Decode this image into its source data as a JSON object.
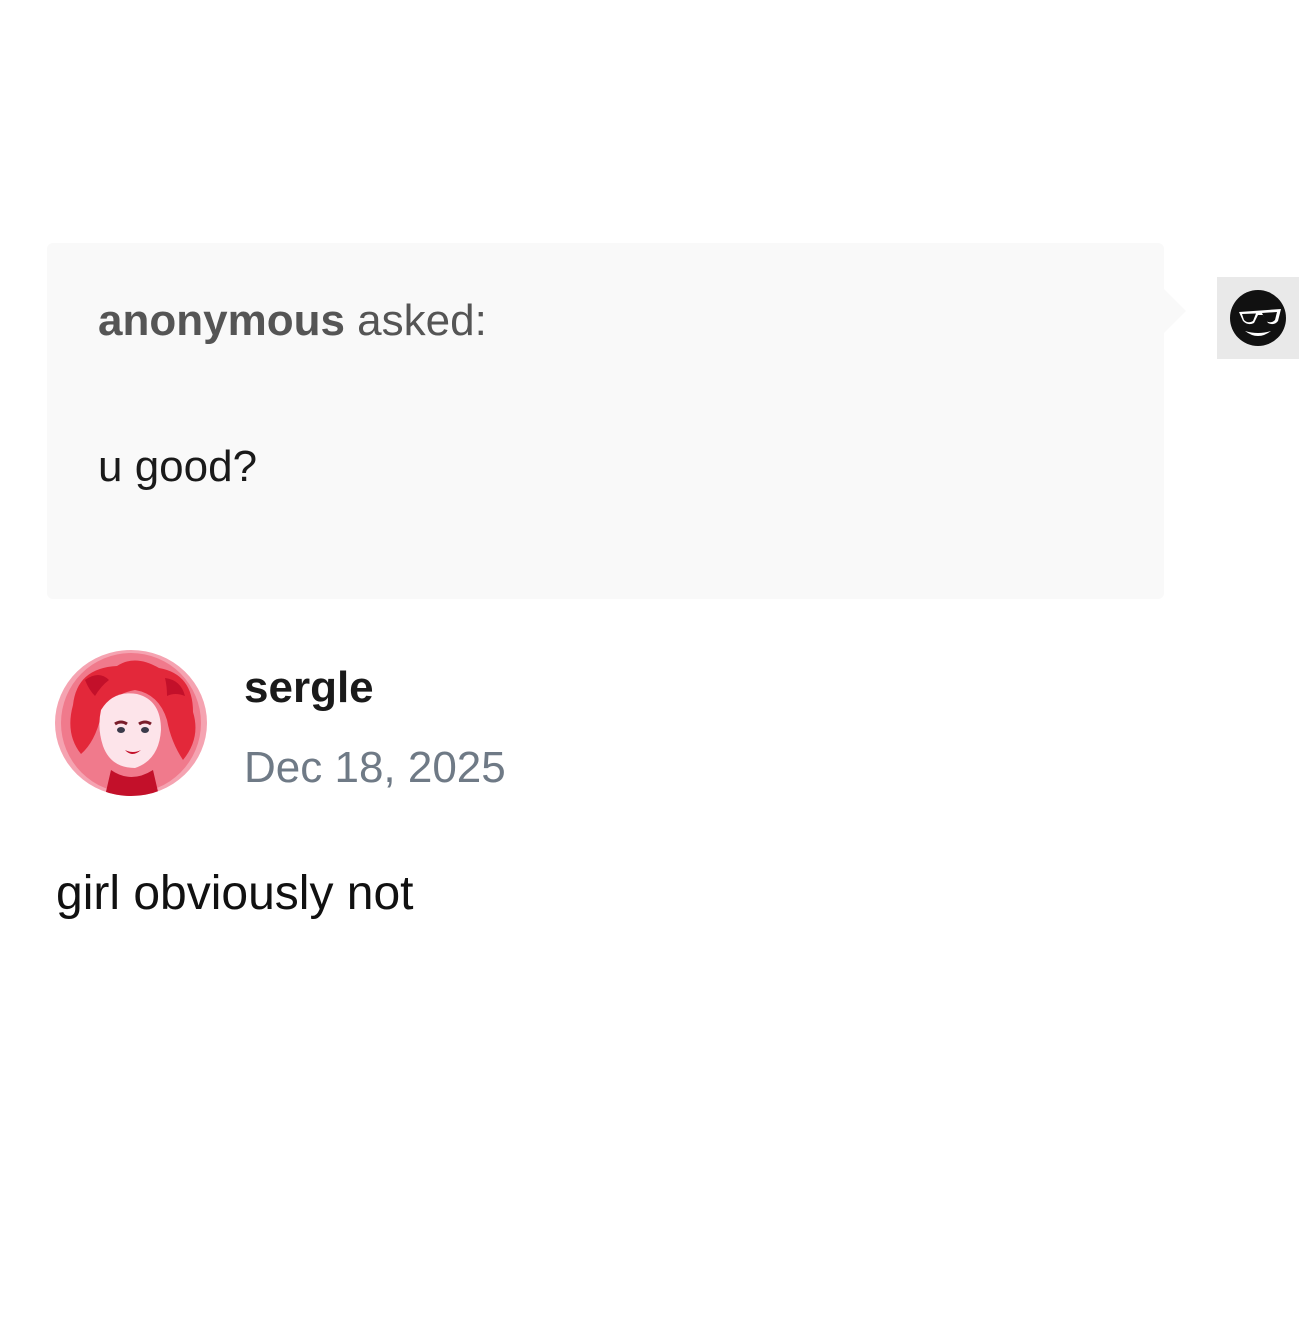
{
  "ask": {
    "asker_name": "anonymous",
    "asked_label": "asked:",
    "question": "u good?"
  },
  "answer": {
    "username": "sergle",
    "date": "Dec 18, 2025",
    "text": "girl obviously not"
  },
  "icons": {
    "asker_avatar": "anonymous-sunglasses-avatar-icon",
    "answerer_avatar": "red-haired-character-avatar"
  },
  "colors": {
    "bubble_background": "#f9f9f9",
    "date_text": "#6f7a86",
    "avatar_pink": "#f07a8c",
    "avatar_red": "#e3283a"
  }
}
